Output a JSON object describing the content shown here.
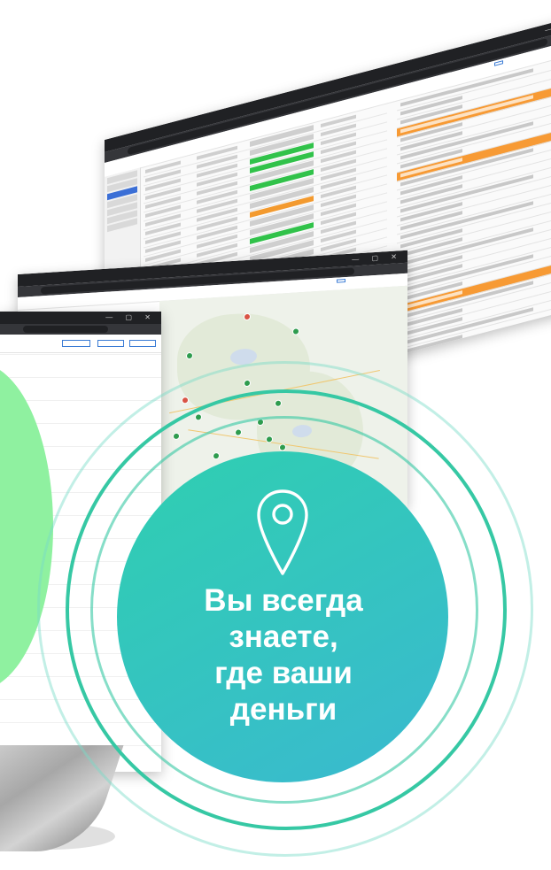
{
  "slogan_lines": [
    "Вы всегда",
    "знаете,",
    "где ваши",
    "деньги"
  ],
  "icons": {
    "location": "location-pin-icon"
  },
  "colors": {
    "circle_start": "#2fcfb0",
    "circle_end": "#3ab9d0",
    "ring": "#36c8a4",
    "blob": "#8ff1a0",
    "row_green": "#31c24a",
    "row_orange": "#f79a34"
  }
}
